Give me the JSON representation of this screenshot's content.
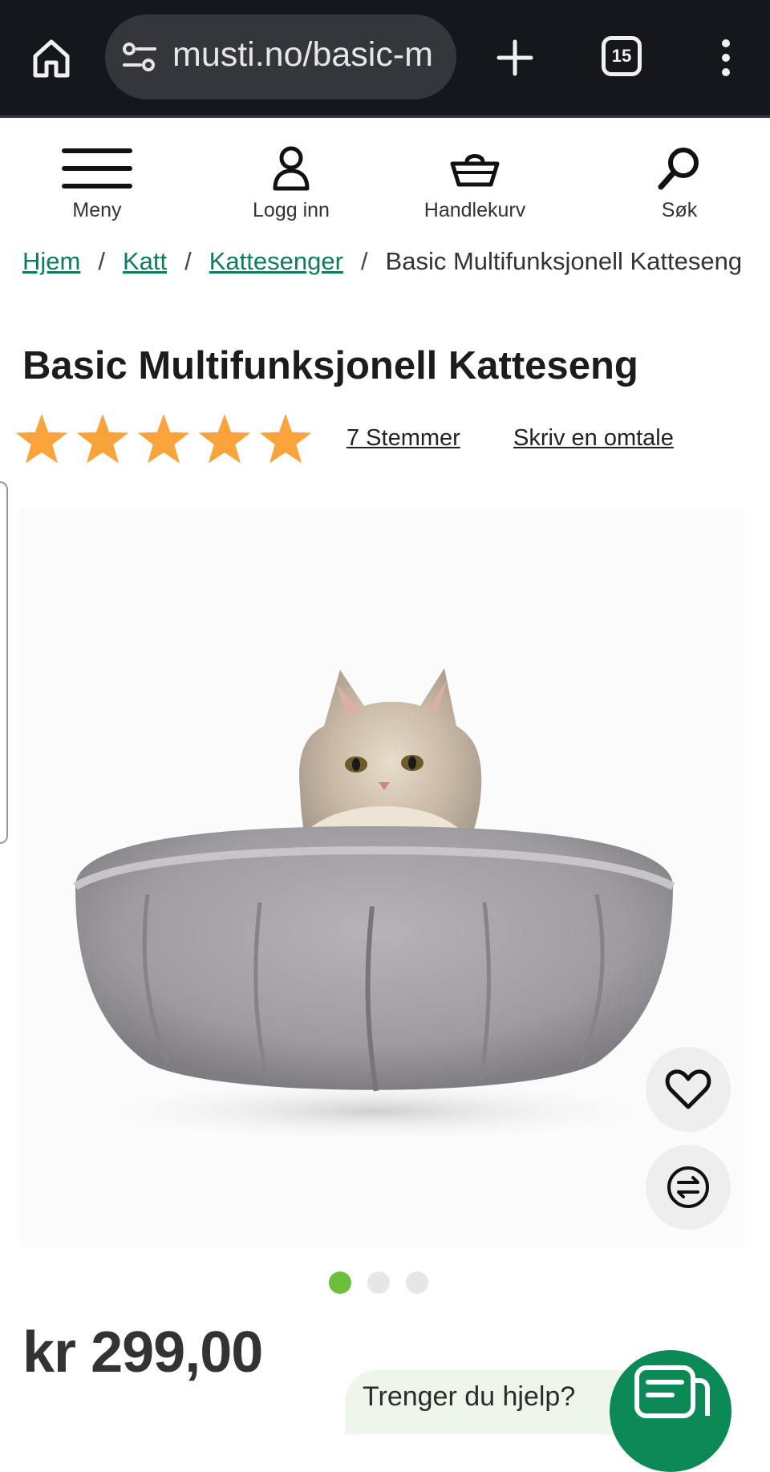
{
  "browser": {
    "url": "musti.no/basic-m",
    "tab_count": "15",
    "icons": [
      "home-icon",
      "site-settings-icon",
      "plus-icon",
      "tabs-icon",
      "more-vert-icon"
    ]
  },
  "nav": {
    "menu_label": "Meny",
    "login_label": "Logg inn",
    "cart_label": "Handlekurv",
    "search_label": "Søk"
  },
  "breadcrumb": {
    "items": [
      "Hjem",
      "Katt",
      "Kattesenger"
    ],
    "current": "Basic Multifunksjonell Katteseng",
    "separator": "/"
  },
  "product": {
    "title": "Basic Multifunksjonell Katteseng",
    "rating": 5,
    "rating_max": 5,
    "votes_label": "7 Stemmer",
    "write_review_label": "Skriv en omtale",
    "price": "kr 299,00",
    "gallery_count": 3,
    "gallery_active_index": 0
  },
  "help": {
    "label": "Trenger du hjelp?"
  },
  "colors": {
    "link_green": "#0b7d5e",
    "star_orange": "#f9a33a",
    "dot_active": "#6cbf3c",
    "help_green": "#0c8a56",
    "browser_bar": "#15171c"
  }
}
